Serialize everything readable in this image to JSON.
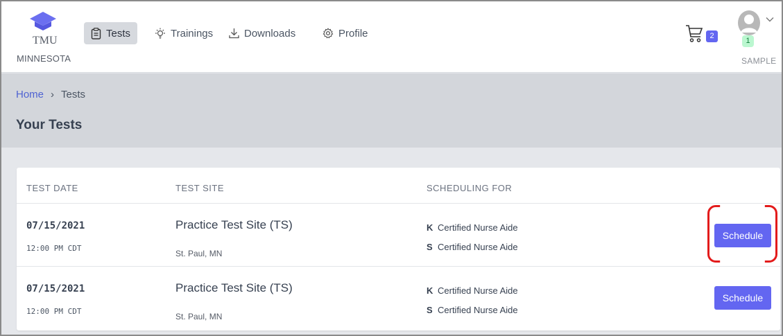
{
  "brand": {
    "short_name": "TMU",
    "state": "MINNESOTA",
    "cap_icon": "graduation-cap-icon"
  },
  "nav": {
    "items": [
      {
        "label": "Tests",
        "icon": "clipboard-icon",
        "active": true
      },
      {
        "label": "Trainings",
        "icon": "lightbulb-icon",
        "active": false
      },
      {
        "label": "Downloads",
        "icon": "download-icon",
        "active": false
      },
      {
        "label": "Profile",
        "icon": "gear-icon",
        "active": false
      }
    ]
  },
  "cart": {
    "count": "2",
    "icon": "cart-icon"
  },
  "user": {
    "notification_count": "1",
    "name": "SAMPLE",
    "icon": "avatar-icon",
    "menu_icon": "chevron-down-icon"
  },
  "breadcrumb": {
    "home": "Home",
    "separator": "›",
    "current": "Tests"
  },
  "page": {
    "title": "Your Tests"
  },
  "table": {
    "headers": [
      "TEST DATE",
      "TEST SITE",
      "SCHEDULING FOR"
    ],
    "rows": [
      {
        "date": "07/15/2021",
        "time": "12:00 PM CDT",
        "site": "Practice Test Site (TS)",
        "location": "St. Paul, MN",
        "scheduling": [
          {
            "code": "K",
            "program": "Certified Nurse Aide"
          },
          {
            "code": "S",
            "program": "Certified Nurse Aide"
          }
        ],
        "action": "Schedule"
      },
      {
        "date": "07/15/2021",
        "time": "12:00 PM CDT",
        "site": "Practice Test Site (TS)",
        "location": "St. Paul, MN",
        "scheduling": [
          {
            "code": "K",
            "program": "Certified Nurse Aide"
          },
          {
            "code": "S",
            "program": "Certified Nurse Aide"
          }
        ],
        "action": "Schedule"
      }
    ]
  },
  "colors": {
    "accent": "#6366f1",
    "link": "#4f63d2",
    "highlight": "#e31b1b",
    "band": "#d3d6db"
  }
}
